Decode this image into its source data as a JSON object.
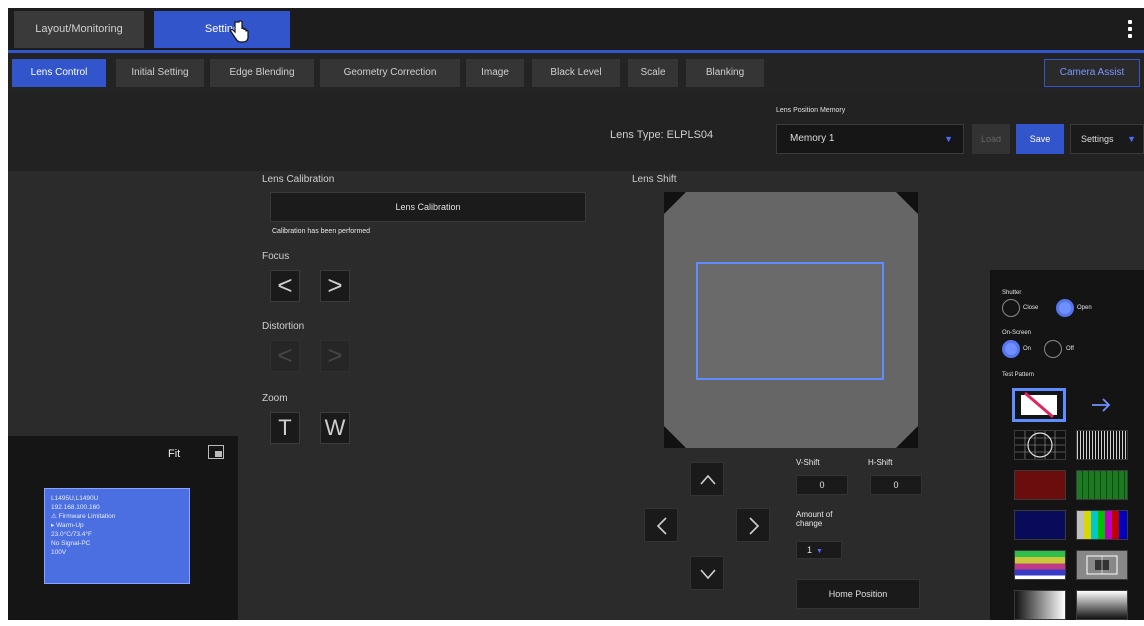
{
  "header": {
    "tabs": [
      {
        "label": "Layout/Monitoring",
        "active": false
      },
      {
        "label": "Setting",
        "active": true
      }
    ]
  },
  "subtabs": [
    {
      "label": "Lens Control",
      "active": true
    },
    {
      "label": "Initial Setting",
      "active": false
    },
    {
      "label": "Edge Blending",
      "active": false
    },
    {
      "label": "Geometry Correction",
      "active": false
    },
    {
      "label": "Image",
      "active": false
    },
    {
      "label": "Black Level",
      "active": false
    },
    {
      "label": "Scale",
      "active": false
    },
    {
      "label": "Blanking",
      "active": false
    }
  ],
  "camera_assist_label": "Camera Assist",
  "lens": {
    "type": "Lens Type: ELPLS04"
  },
  "memory": {
    "title": "Lens Position Memory",
    "selected": "Memory 1",
    "load_label": "Load",
    "save_label": "Save",
    "settings_label": "Settings"
  },
  "calibration": {
    "title": "Lens Calibration",
    "button_label": "Lens Calibration",
    "status": "Calibration has been performed"
  },
  "focus": {
    "title": "Focus",
    "left": "<",
    "right": ">"
  },
  "distortion": {
    "title": "Distortion",
    "left": "<",
    "right": ">"
  },
  "zoom": {
    "title": "Zoom",
    "tele": "T",
    "wide": "W"
  },
  "shift": {
    "title": "Lens Shift",
    "v_label": "V-Shift",
    "v_value": "0",
    "h_label": "H-Shift",
    "h_value": "0",
    "amount_label": "Amount of change",
    "amount_value": "1",
    "home_label": "Home Position"
  },
  "side": {
    "shutter_label": "Shutter",
    "shutter_close": "Close",
    "shutter_open": "Open",
    "osd_label": "On-Screen",
    "osd_on": "On",
    "osd_off": "Off",
    "test_pattern_label": "Test Pattern"
  },
  "preview": {
    "fit_label": "Fit",
    "info_lines": [
      "L1495U,L1490U",
      "192.168.100.160",
      "⚠ Firmware Limitation",
      "▸ Warm-Up",
      "23.0°C/73.4°F",
      "No Signal-PC",
      "100V"
    ]
  },
  "colors": {
    "accent": "#3355cc",
    "panel_bg": "#2b2b2b",
    "header_bg": "#1c1c1c"
  }
}
